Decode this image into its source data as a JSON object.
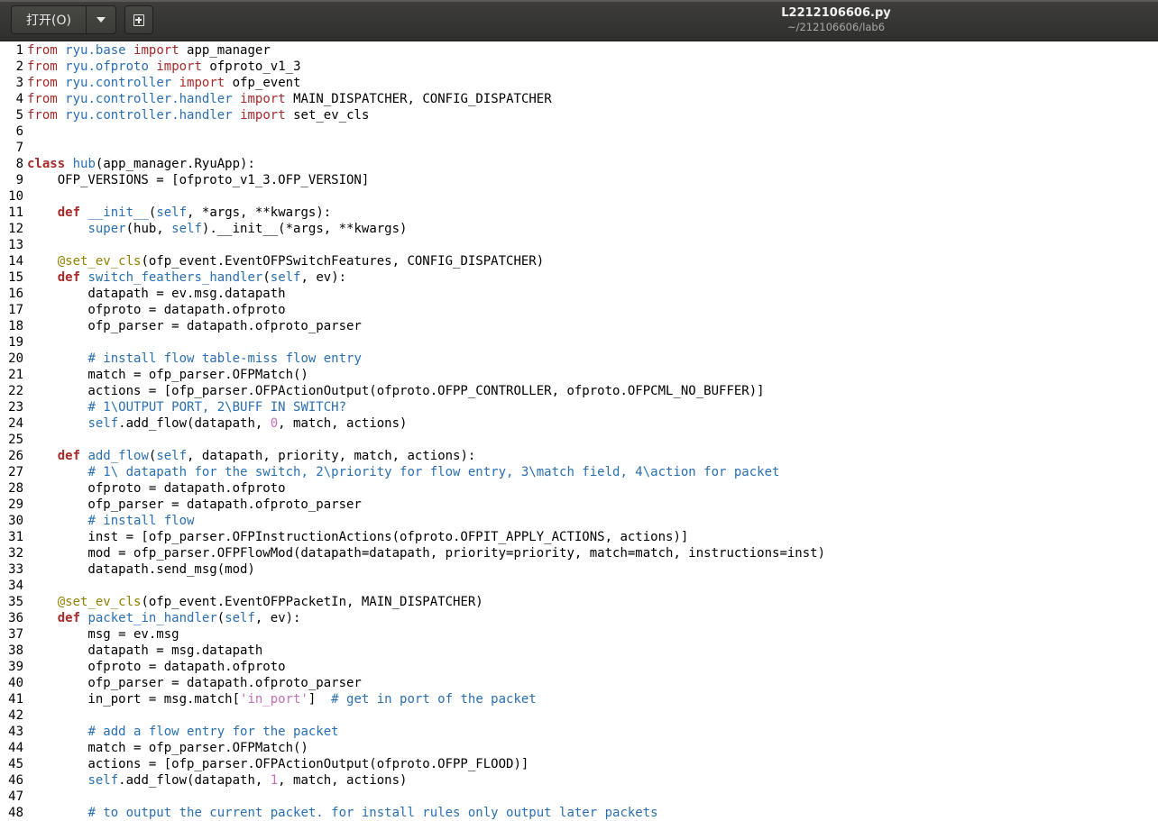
{
  "header": {
    "open_label": "打开(O)",
    "file_name": "L2212106606.py",
    "file_path": "~/212106606/lab6"
  },
  "colors": {
    "keyword": "#a52a2a",
    "identifier": "#2a6fb0",
    "comment": "#2a6fb0",
    "number": "#c46fb8",
    "decorator": "#908000"
  },
  "editor": {
    "lines": [
      {
        "n": "1",
        "t": "from ryu.base import app_manager"
      },
      {
        "n": "2",
        "t": "from ryu.ofproto import ofproto_v1_3"
      },
      {
        "n": "3",
        "t": "from ryu.controller import ofp_event"
      },
      {
        "n": "4",
        "t": "from ryu.controller.handler import MAIN_DISPATCHER, CONFIG_DISPATCHER"
      },
      {
        "n": "5",
        "t": "from ryu.controller.handler import set_ev_cls"
      },
      {
        "n": "6",
        "t": ""
      },
      {
        "n": "7",
        "t": ""
      },
      {
        "n": "8",
        "t": "class hub(app_manager.RyuApp):"
      },
      {
        "n": "9",
        "t": "    OFP_VERSIONS = [ofproto_v1_3.OFP_VERSION]"
      },
      {
        "n": "10",
        "t": ""
      },
      {
        "n": "11",
        "t": "    def __init__(self, *args, **kwargs):"
      },
      {
        "n": "12",
        "t": "        super(hub, self).__init__(*args, **kwargs)"
      },
      {
        "n": "13",
        "t": ""
      },
      {
        "n": "14",
        "t": "    @set_ev_cls(ofp_event.EventOFPSwitchFeatures, CONFIG_DISPATCHER)"
      },
      {
        "n": "15",
        "t": "    def switch_feathers_handler(self, ev):"
      },
      {
        "n": "16",
        "t": "        datapath = ev.msg.datapath"
      },
      {
        "n": "17",
        "t": "        ofproto = datapath.ofproto"
      },
      {
        "n": "18",
        "t": "        ofp_parser = datapath.ofproto_parser"
      },
      {
        "n": "19",
        "t": ""
      },
      {
        "n": "20",
        "t": "        # install flow table-miss flow entry"
      },
      {
        "n": "21",
        "t": "        match = ofp_parser.OFPMatch()"
      },
      {
        "n": "22",
        "t": "        actions = [ofp_parser.OFPActionOutput(ofproto.OFPP_CONTROLLER, ofproto.OFPCML_NO_BUFFER)]"
      },
      {
        "n": "23",
        "t": "        # 1\\OUTPUT PORT, 2\\BUFF IN SWITCH?"
      },
      {
        "n": "24",
        "t": "        self.add_flow(datapath, 0, match, actions)"
      },
      {
        "n": "25",
        "t": ""
      },
      {
        "n": "26",
        "t": "    def add_flow(self, datapath, priority, match, actions):"
      },
      {
        "n": "27",
        "t": "        # 1\\ datapath for the switch, 2\\priority for flow entry, 3\\match field, 4\\action for packet"
      },
      {
        "n": "28",
        "t": "        ofproto = datapath.ofproto"
      },
      {
        "n": "29",
        "t": "        ofp_parser = datapath.ofproto_parser"
      },
      {
        "n": "30",
        "t": "        # install flow"
      },
      {
        "n": "31",
        "t": "        inst = [ofp_parser.OFPInstructionActions(ofproto.OFPIT_APPLY_ACTIONS, actions)]"
      },
      {
        "n": "32",
        "t": "        mod = ofp_parser.OFPFlowMod(datapath=datapath, priority=priority, match=match, instructions=inst)"
      },
      {
        "n": "33",
        "t": "        datapath.send_msg(mod)"
      },
      {
        "n": "34",
        "t": ""
      },
      {
        "n": "35",
        "t": "    @set_ev_cls(ofp_event.EventOFPPacketIn, MAIN_DISPATCHER)"
      },
      {
        "n": "36",
        "t": "    def packet_in_handler(self, ev):"
      },
      {
        "n": "37",
        "t": "        msg = ev.msg"
      },
      {
        "n": "38",
        "t": "        datapath = msg.datapath"
      },
      {
        "n": "39",
        "t": "        ofproto = datapath.ofproto"
      },
      {
        "n": "40",
        "t": "        ofp_parser = datapath.ofproto_parser"
      },
      {
        "n": "41",
        "t": "        in_port = msg.match['in_port']  # get in port of the packet"
      },
      {
        "n": "42",
        "t": ""
      },
      {
        "n": "43",
        "t": "        # add a flow entry for the packet"
      },
      {
        "n": "44",
        "t": "        match = ofp_parser.OFPMatch()"
      },
      {
        "n": "45",
        "t": "        actions = [ofp_parser.OFPActionOutput(ofproto.OFPP_FLOOD)]"
      },
      {
        "n": "46",
        "t": "        self.add_flow(datapath, 1, match, actions)"
      },
      {
        "n": "47",
        "t": ""
      },
      {
        "n": "48",
        "t": "        # to output the current packet. for install rules only output later packets"
      }
    ]
  }
}
